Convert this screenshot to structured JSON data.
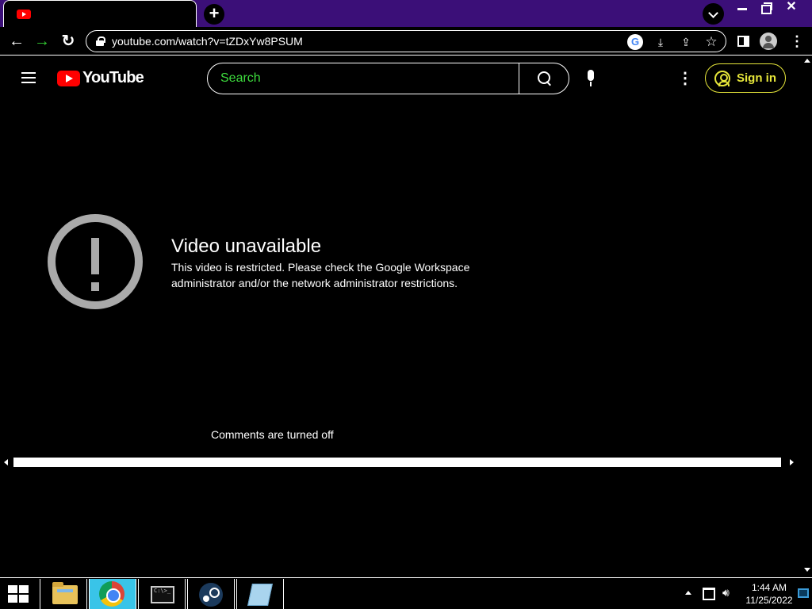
{
  "browser": {
    "tab_title": "",
    "new_tab_symbol": "+",
    "url": "youtube.com/watch?v=tZDxYw8PSUM",
    "window_controls": {
      "close_symbol": "✕"
    },
    "nav": {
      "back": "←",
      "forward": "→",
      "reload": "↻"
    },
    "menu_symbol": "⋮",
    "accent_colors": {
      "tabstrip": "#3b0f78",
      "forward": "#33cc33"
    }
  },
  "youtube": {
    "logo_text": "YouTube",
    "search": {
      "placeholder": "Search"
    },
    "menu_symbol": "⋮",
    "sign_in_label": "Sign in",
    "error": {
      "title": "Video unavailable",
      "message": "This video is restricted. Please check the Google Workspace administrator and/or the network administrator restrictions."
    },
    "comments_status": "Comments are turned off",
    "colors": {
      "brand_red": "#ff0000",
      "search_placeholder": "#3ddc3d",
      "sign_in": "#e6e63a",
      "error_icon": "#aaaaaa"
    }
  },
  "taskbar": {
    "apps": [
      "file-explorer",
      "chrome",
      "command-prompt",
      "steam",
      "notepad"
    ],
    "cmd_prompt_text": "C:\\>_",
    "clock_time": "1:44 AM",
    "clock_date": "11/25/2022"
  }
}
